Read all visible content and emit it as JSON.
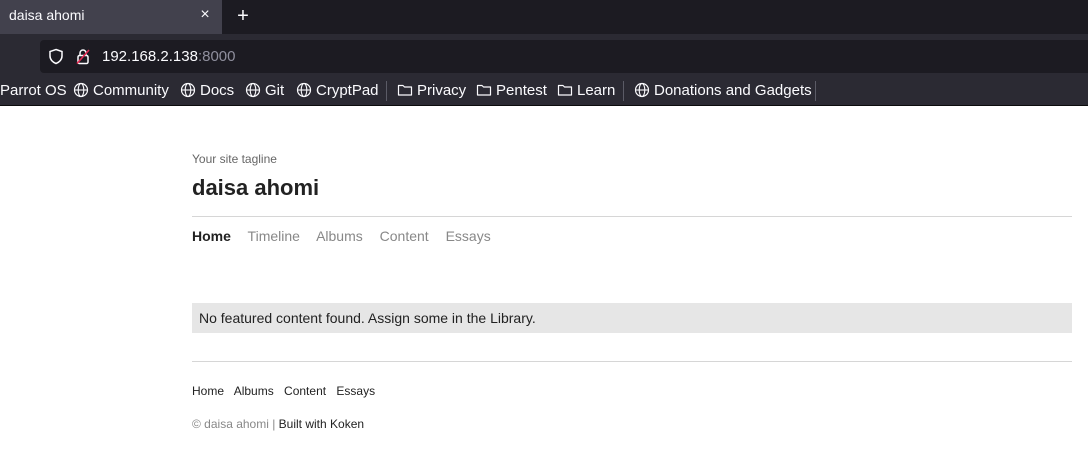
{
  "browser": {
    "tab_title": "daisa ahomi",
    "tab_close": "×",
    "new_tab": "+",
    "url_host": "192.168.2.138",
    "url_port": ":8000",
    "bookmarks": [
      {
        "label": "Parrot OS",
        "icon": "none"
      },
      {
        "label": "Community",
        "icon": "globe-icon"
      },
      {
        "label": "Docs",
        "icon": "globe-icon"
      },
      {
        "label": "Git",
        "icon": "globe-icon"
      },
      {
        "label": "CryptPad",
        "icon": "globe-icon"
      },
      {
        "label": "Privacy",
        "icon": "folder-icon"
      },
      {
        "label": "Pentest",
        "icon": "folder-icon"
      },
      {
        "label": "Learn",
        "icon": "folder-icon"
      },
      {
        "label": "Donations and Gadgets",
        "icon": "globe-icon"
      }
    ]
  },
  "site": {
    "tagline": "Your site tagline",
    "title": "daisa ahomi",
    "nav": [
      "Home",
      "Timeline",
      "Albums",
      "Content",
      "Essays"
    ],
    "active_nav": "Home",
    "notice": "No featured content found. Assign some in the Library.",
    "footer_nav": [
      "Home",
      "Albums",
      "Content",
      "Essays"
    ],
    "copyright": "© daisa ahomi | ",
    "built_with": "Built with Koken"
  },
  "colors": {
    "chrome_bg": "#2b2a33",
    "tabstrip_bg": "#1c1b22",
    "active_tab_bg": "#42414d",
    "notice_bg": "#e6e6e6",
    "nav_inactive": "#888888",
    "text_dark": "#222222"
  }
}
